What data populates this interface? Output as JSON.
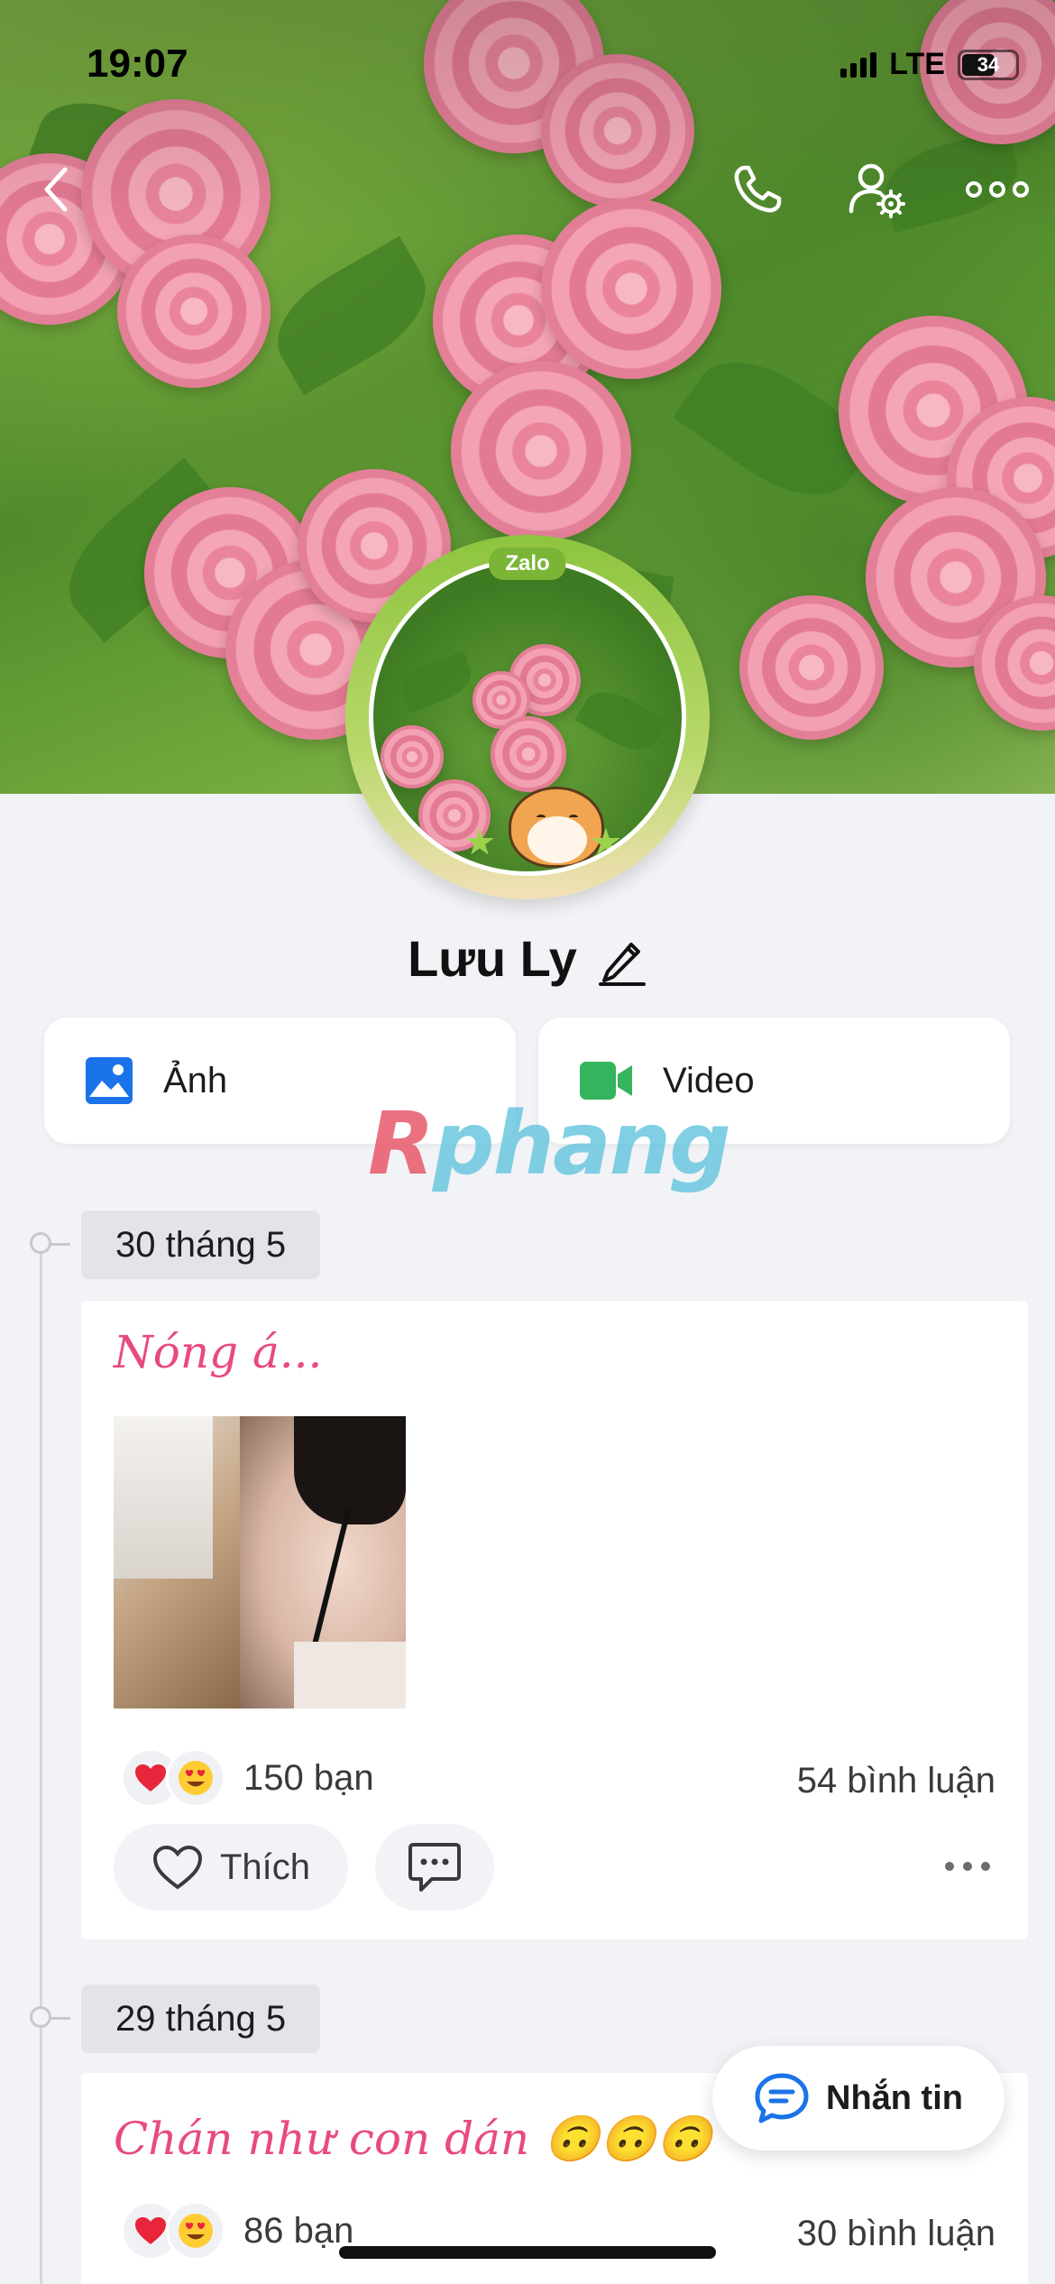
{
  "status_bar": {
    "time": "19:07",
    "network": "LTE",
    "battery": "34"
  },
  "header": {
    "back_icon": "chevron-left-icon",
    "call_icon": "phone-icon",
    "settings_icon": "user-settings-icon",
    "more_icon": "more-horizontal-icon"
  },
  "profile": {
    "name": "Lưu Ly",
    "avatar_badge": "Zalo",
    "edit_icon": "pencil-icon"
  },
  "media": {
    "photos_label": "Ảnh",
    "videos_label": "Video",
    "photo_color": "#1a73e8",
    "video_color": "#34b45c"
  },
  "watermark": "Rphang",
  "posts": [
    {
      "date": "30 tháng 5",
      "text": "Nóng á...",
      "reactions": [
        "heart",
        "heart-eyes"
      ],
      "reaction_count": "150 bạn",
      "comment_count": "54 bình luận",
      "like_label": "Thích"
    },
    {
      "date": "29 tháng 5",
      "text": "Chán như con dán 🙃🙃🙃",
      "reactions": [
        "heart",
        "heart-eyes"
      ],
      "reaction_count": "86 bạn",
      "comment_count": "30 bình luận"
    }
  ],
  "message_button": {
    "label": "Nhắn tin",
    "accent": "#1a73e8"
  }
}
